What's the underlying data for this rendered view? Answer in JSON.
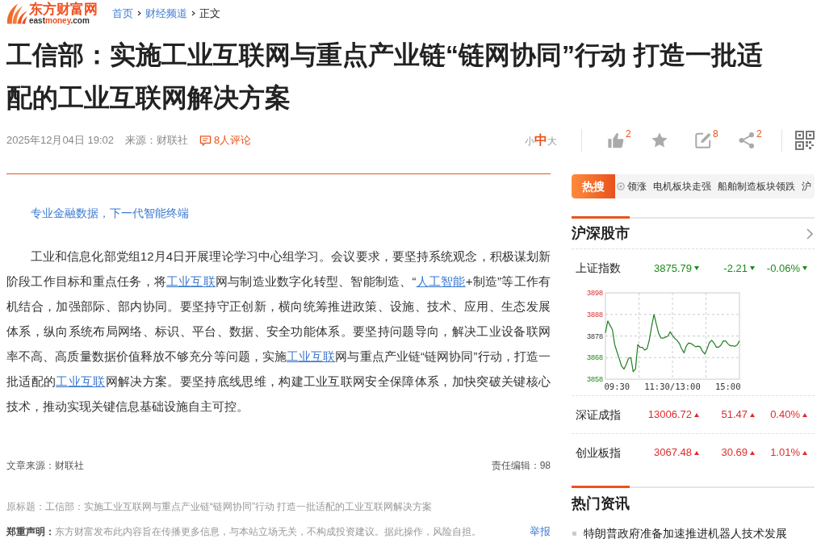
{
  "header": {
    "logo": {
      "name": "东方财富网",
      "domain": [
        "east",
        "money",
        ".com"
      ]
    },
    "breadcrumb": [
      {
        "label": "首页",
        "kind": "link"
      },
      {
        "label": "财经频道",
        "kind": "link"
      },
      {
        "label": "正文",
        "kind": "current"
      }
    ]
  },
  "article": {
    "title": "工信部：实施工业互联网与重点产业链“链网协同”行动 打造一批适配的工业互联网解决方案",
    "promo_link": "专业金融数据，下一代智能终端",
    "body": [
      {
        "kind": "text",
        "text": "工业和信息化部党组12月4日开展理论学习中心组学习。会议要求，要坚持系统观念，积极谋划新阶段工作目标和重点任务，将"
      },
      {
        "kind": "link",
        "text": "工业互联"
      },
      {
        "kind": "text",
        "text": "网与制造业数字化转型、智能制造、“"
      },
      {
        "kind": "link",
        "text": "人工智能"
      },
      {
        "kind": "text",
        "text": "+制造”等工作有机结合，加强部际、部内协同。要坚持守正创新，横向统筹推进政策、设施、技术、应用、生态发展体系，纵向系统布局网络、标识、平台、数据、安全功能体系。要坚持问题导向，解决工业设备联网率不高、高质量数据价值释放不够充分等问题，实施"
      },
      {
        "kind": "link",
        "text": "工业互联"
      },
      {
        "kind": "text",
        "text": "网与重点产业链“链网协同”行动，打造一批适配的"
      },
      {
        "kind": "link",
        "text": "工业互联"
      },
      {
        "kind": "text",
        "text": "网解决方案。要坚持底线思维，构建工业互联网安全保障体系，加快突破关键核心技术，推动实现关键信息基础设施自主可控。"
      }
    ],
    "source": "文章来源：财联社",
    "editor": "责任编辑：98",
    "original_title": "原标题：工信部：实施工业互联网与重点产业链“链网协同”行动 打造一批适配的工业互联网解决方案",
    "disclaimer": {
      "text": "**郑重声明：**东方财富发布此内容旨在传播更多信息，与本站立场无关，不构成投资建议。据此操作，风险自担。",
      "report": "举报"
    }
  },
  "meta": {
    "datetime": "2025年12月04日 19:02",
    "source": "来源：财联社",
    "comments": "8人评论",
    "font_sizes": [
      {
        "label": "小",
        "selected": false
      },
      {
        "label": "中",
        "selected": true
      },
      {
        "label": "大",
        "selected": false
      }
    ],
    "actions": [
      {
        "kind": "like",
        "count": "2"
      },
      {
        "kind": "favorite"
      },
      {
        "kind": "comment",
        "count": "8"
      },
      {
        "kind": "share",
        "count": "2"
      },
      {
        "kind": "qrcode"
      }
    ]
  },
  "hot_search": {
    "label": "热搜",
    "items": [
      "领涨",
      "电机板块走强",
      "船舶制造板块领跌",
      "沪"
    ]
  },
  "market": {
    "title": "沪深股市",
    "indices": [
      {
        "name": "上证指数",
        "price": "3875.79",
        "change": "-2.21",
        "percent": "-0.06%",
        "rising": false
      },
      {
        "name": "深证成指",
        "price": "13006.72",
        "change": "51.47",
        "percent": "0.40%",
        "rising": true
      },
      {
        "name": "创业板指",
        "price": "3067.48",
        "change": "30.69",
        "percent": "1.01%",
        "rising": true
      }
    ],
    "chart_data": [
      {
        "type": "line",
        "categories": [
          null,
          null,
          null,
          null,
          null,
          "09:30",
          null,
          null,
          null,
          null,
          null,
          null,
          null,
          null,
          null,
          null,
          null,
          null,
          null,
          null,
          null,
          null,
          null,
          null,
          null,
          null,
          null,
          null,
          null,
          "11:30/13:00",
          null,
          null,
          null,
          null,
          null,
          null,
          null,
          null,
          null,
          null,
          null,
          null,
          null,
          null,
          null,
          null,
          null,
          null,
          null,
          null,
          null,
          null,
          null,
          "15:00",
          null,
          null,
          null,
          null,
          null
        ],
        "values": [
          3879.5,
          3885,
          3882.9,
          3881,
          3874,
          3870.6,
          3867.4,
          3864,
          3862.7,
          3864.8,
          3867.7,
          3868,
          3861.5,
          3862.7,
          3874,
          3872.8,
          3872.7,
          3871.5,
          3872.1,
          3876.3,
          3882.5,
          3888,
          3883.6,
          3879.3,
          3877.1,
          3877,
          3877.5,
          3877.9,
          3880,
          3878.2,
          3876.9,
          3876,
          3874.5,
          3872,
          3870.2,
          3873.4,
          3874.8,
          3874.5,
          3873.8,
          3873,
          3873.3,
          3873,
          3870.9,
          3869.6,
          3872,
          3875,
          3876,
          3874.7,
          3872.8,
          3872.8,
          3873.8,
          3875.7,
          3875.7,
          3874.4,
          3873.5,
          3873.5,
          3873.2,
          3873.9,
          3875.7
        ],
        "color": "#1f7f1f",
        "yticks": [
          3858,
          3868,
          3878,
          3888,
          3898
        ],
        "ylim": [
          3858,
          3898
        ],
        "grid": true
      }
    ]
  },
  "hot_news": {
    "title": "热门资讯",
    "items": [
      "特朗普政府准备加速推进机器人技术发展"
    ]
  }
}
